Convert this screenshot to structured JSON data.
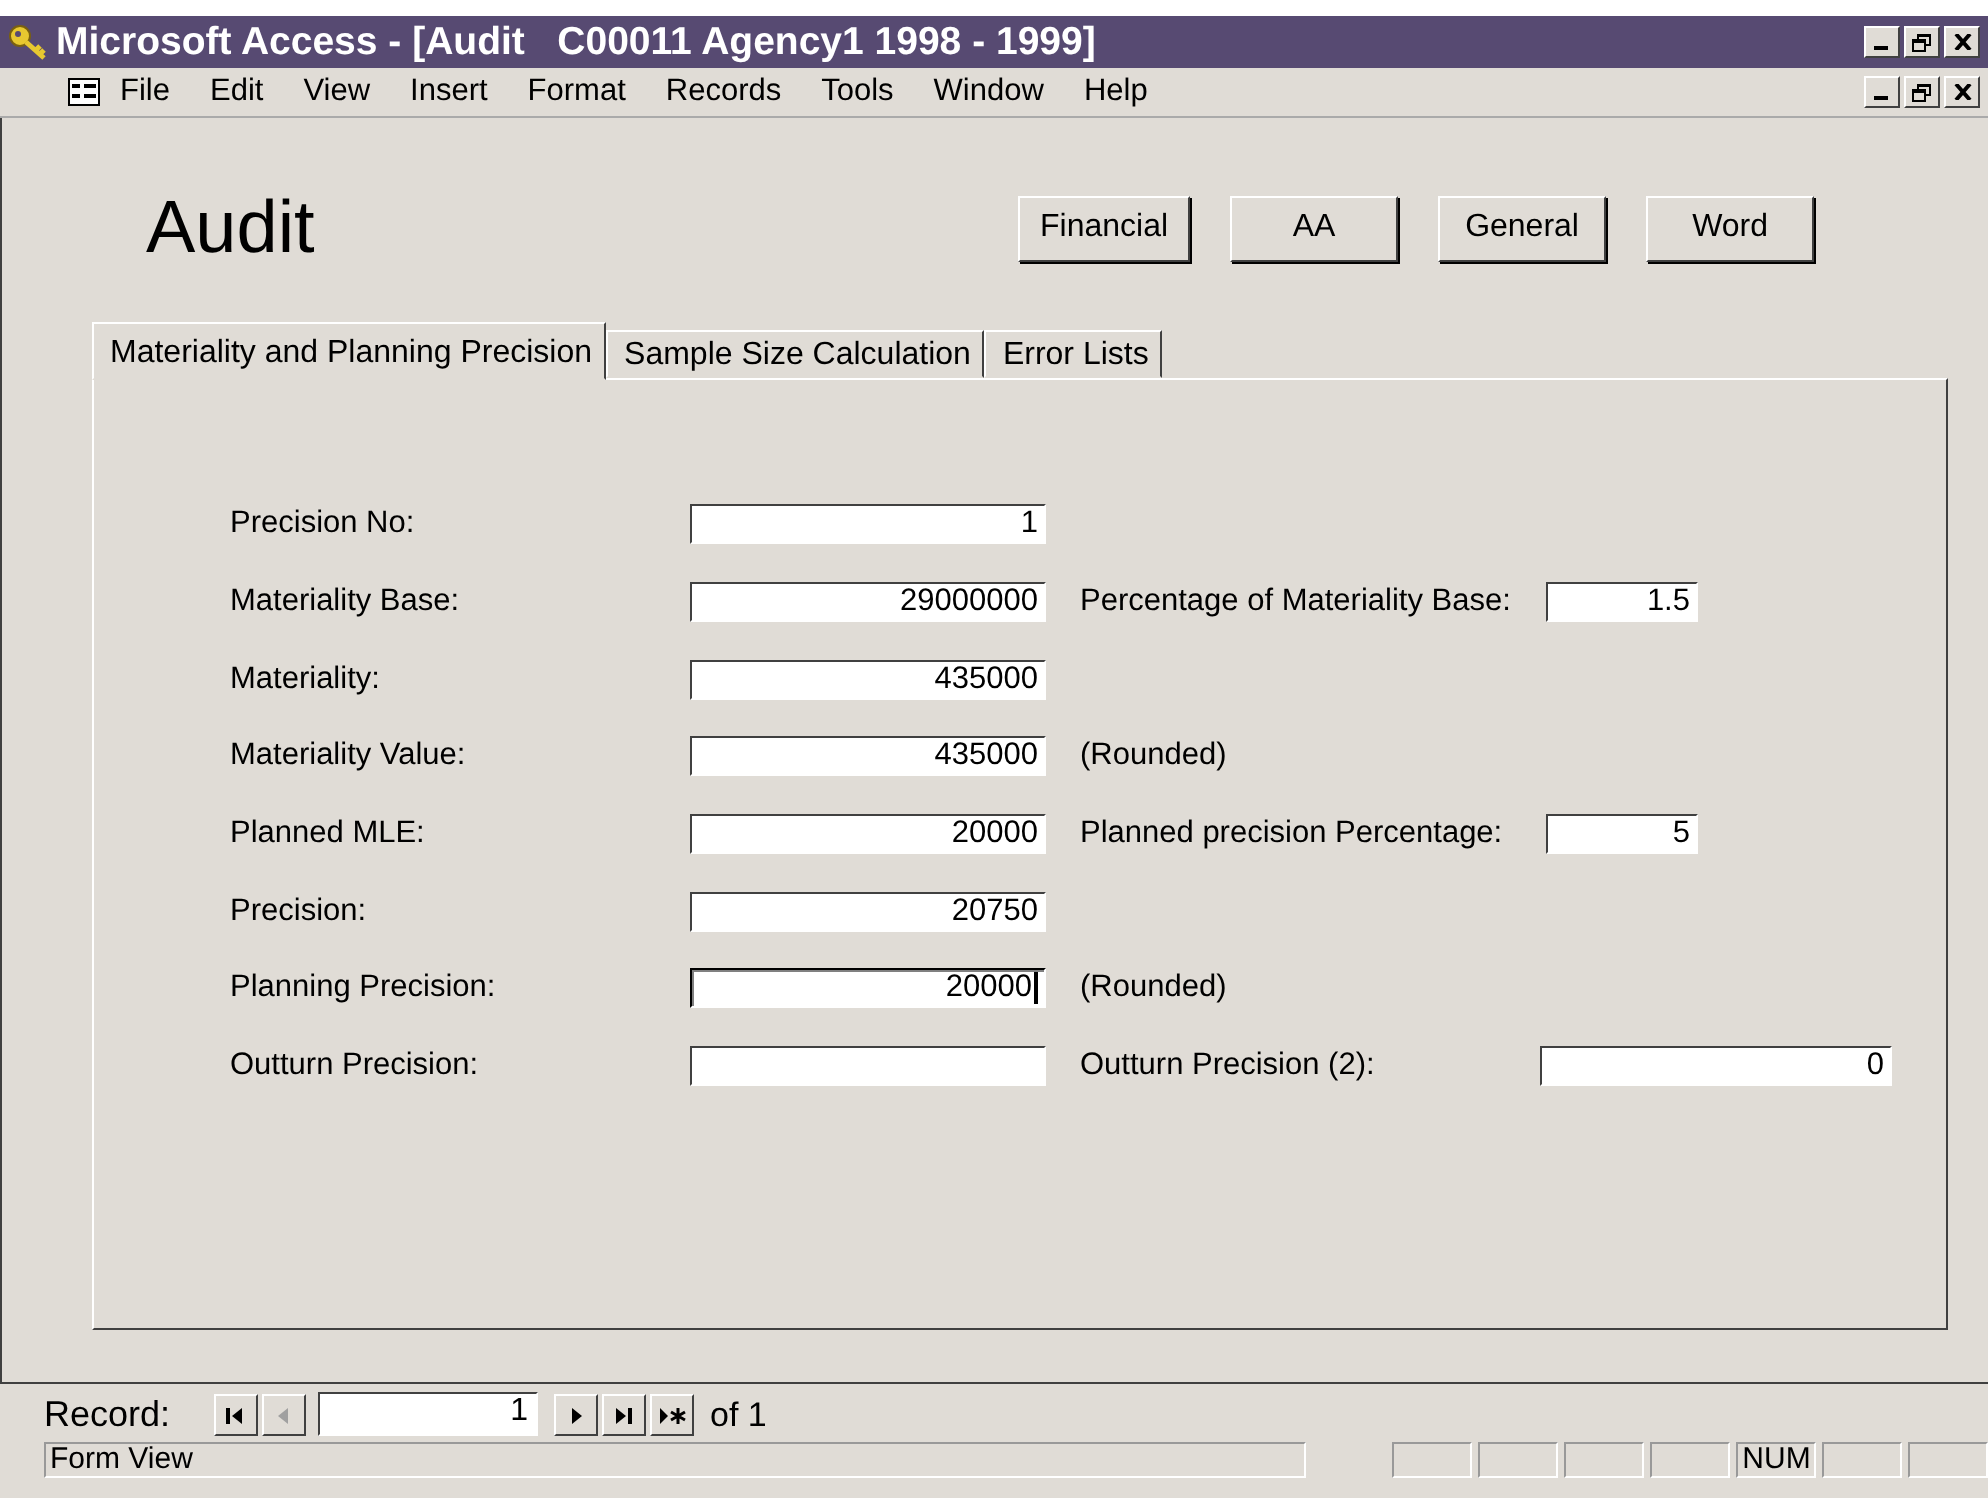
{
  "window": {
    "title": "Microsoft Access - [Audit   C00011 Agency1 1998 - 1999]"
  },
  "menu": [
    "File",
    "Edit",
    "View",
    "Insert",
    "Format",
    "Records",
    "Tools",
    "Window",
    "Help"
  ],
  "form": {
    "heading": "Audit",
    "buttons": [
      "Financial",
      "AA",
      "General",
      "Word"
    ],
    "tabs": [
      {
        "label": "Materiality and Planning Precision",
        "selected": true
      },
      {
        "label": "Sample Size Calculation",
        "selected": false
      },
      {
        "label": "Error Lists",
        "selected": false
      }
    ],
    "rows": [
      {
        "label": "Precision No:",
        "value": "1",
        "focused": false
      },
      {
        "label": "Materiality Base:",
        "value": "29000000",
        "focused": false,
        "side": {
          "kind": "field",
          "label": "Percentage of Materiality Base:",
          "value": "1.5"
        }
      },
      {
        "label": "Materiality:",
        "value": "435000",
        "focused": false
      },
      {
        "label": "Materiality Value:",
        "value": "435000",
        "focused": false,
        "side": {
          "kind": "note",
          "label": "(Rounded)"
        }
      },
      {
        "label": "Planned MLE:",
        "value": "20000",
        "focused": false,
        "side": {
          "kind": "field",
          "label": "Planned precision Percentage:",
          "value": "5"
        }
      },
      {
        "label": "Precision:",
        "value": "20750",
        "focused": false
      },
      {
        "label": "Planning Precision:",
        "value": "20000",
        "focused": true,
        "side": {
          "kind": "note",
          "label": "(Rounded)"
        }
      },
      {
        "label": "Outturn Precision:",
        "value": "",
        "focused": false,
        "side": {
          "kind": "widefield",
          "label": "Outturn Precision (2):",
          "value": "0"
        }
      }
    ]
  },
  "navigation": {
    "label": "Record:",
    "current": "1",
    "total_label": "of",
    "total": "1"
  },
  "status_bar": {
    "text": "Form View",
    "indicators": [
      {
        "kind": "blank"
      },
      {
        "kind": "blank"
      },
      {
        "kind": "blank"
      },
      {
        "kind": "blank"
      },
      {
        "kind": "text",
        "text": "NUM"
      },
      {
        "kind": "blank"
      },
      {
        "kind": "blank"
      }
    ]
  }
}
